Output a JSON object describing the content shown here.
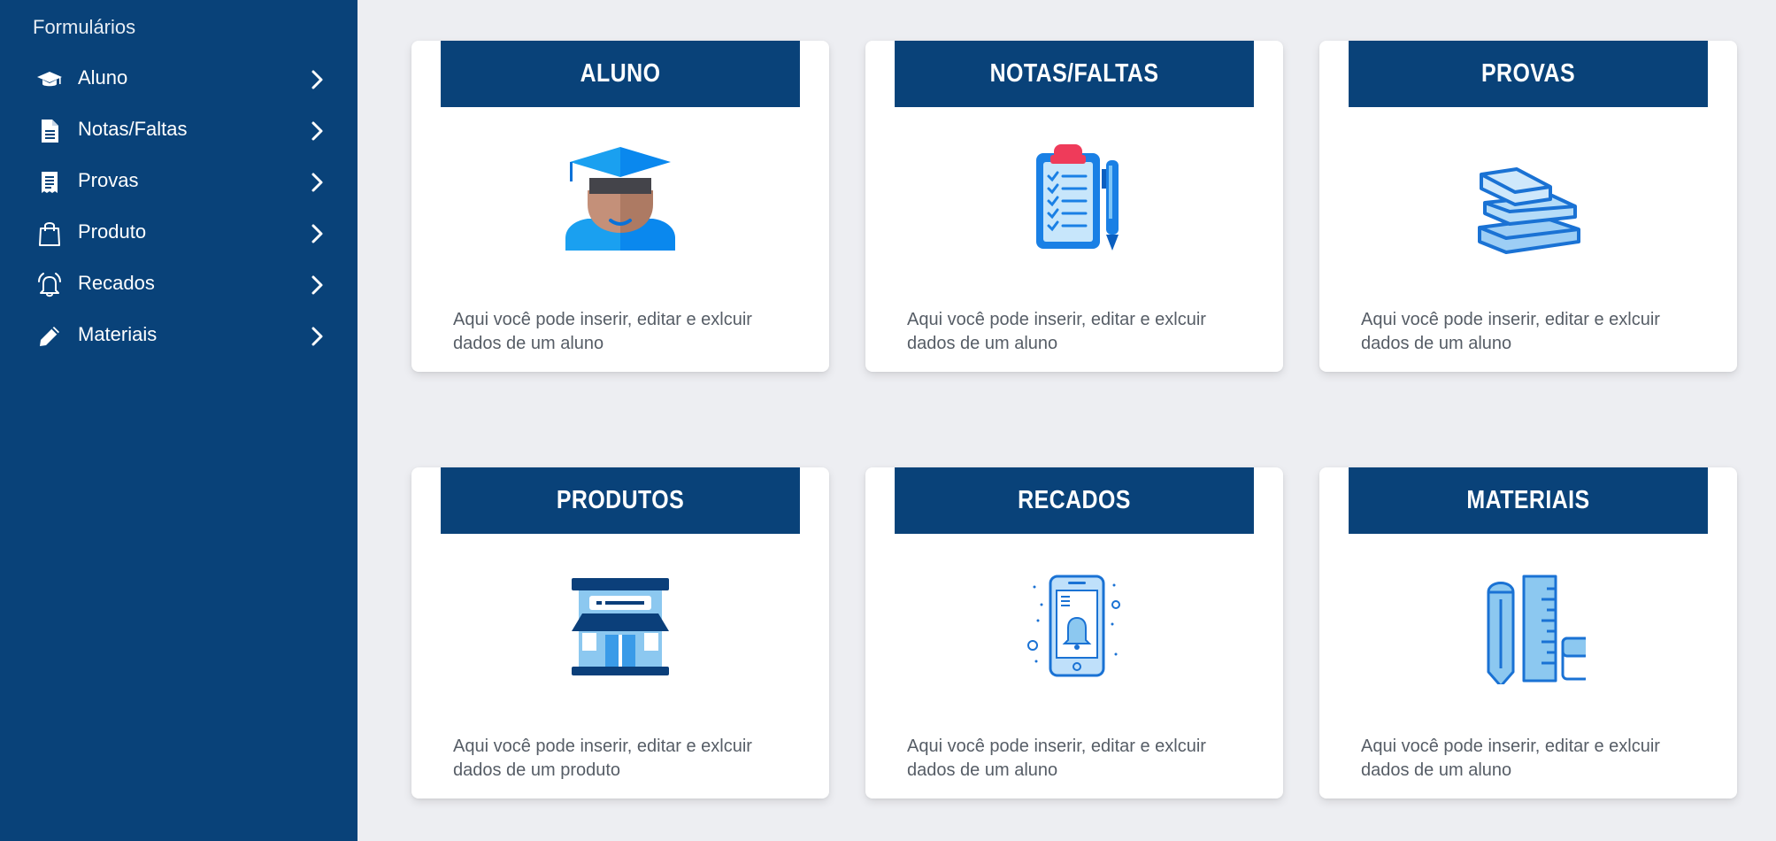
{
  "sidebar": {
    "title": "Formulários",
    "items": [
      {
        "label": "Aluno",
        "icon": "graduation-cap-icon"
      },
      {
        "label": "Notas/Faltas",
        "icon": "document-icon"
      },
      {
        "label": "Provas",
        "icon": "receipt-icon"
      },
      {
        "label": "Produto",
        "icon": "shopping-bag-icon"
      },
      {
        "label": "Recados",
        "icon": "bell-icon"
      },
      {
        "label": "Materiais",
        "icon": "pencil-icon"
      }
    ]
  },
  "cards": [
    {
      "title": "ALUNO",
      "desc_line1": "Aqui você pode inserir, editar e exlcuir",
      "desc_line2": "dados de um aluno",
      "icon": "student-icon"
    },
    {
      "title": "NOTAS/FALTAS",
      "desc_line1": "Aqui você pode inserir, editar e exlcuir",
      "desc_line2": "dados de um aluno",
      "icon": "clipboard-checklist-icon"
    },
    {
      "title": "PROVAS",
      "desc_line1": "Aqui você pode inserir, editar e exlcuir",
      "desc_line2": "dados de um aluno",
      "icon": "books-icon"
    },
    {
      "title": "PRODUTOS",
      "desc_line1": "Aqui você pode inserir, editar e exlcuir",
      "desc_line2": "dados de um produto",
      "icon": "shop-icon"
    },
    {
      "title": "RECADOS",
      "desc_line1": "Aqui você pode inserir, editar e exlcuir",
      "desc_line2": "dados de um aluno",
      "icon": "phone-notification-icon"
    },
    {
      "title": "MATERIAIS",
      "desc_line1": "Aqui você pode inserir, editar e exlcuir",
      "desc_line2": "dados de um aluno",
      "icon": "school-supplies-icon"
    }
  ],
  "colors": {
    "primary": "#094279",
    "background": "#edeef2",
    "card": "#ffffff",
    "text_muted": "#565d66",
    "icon_blue": "#1a80e5"
  }
}
